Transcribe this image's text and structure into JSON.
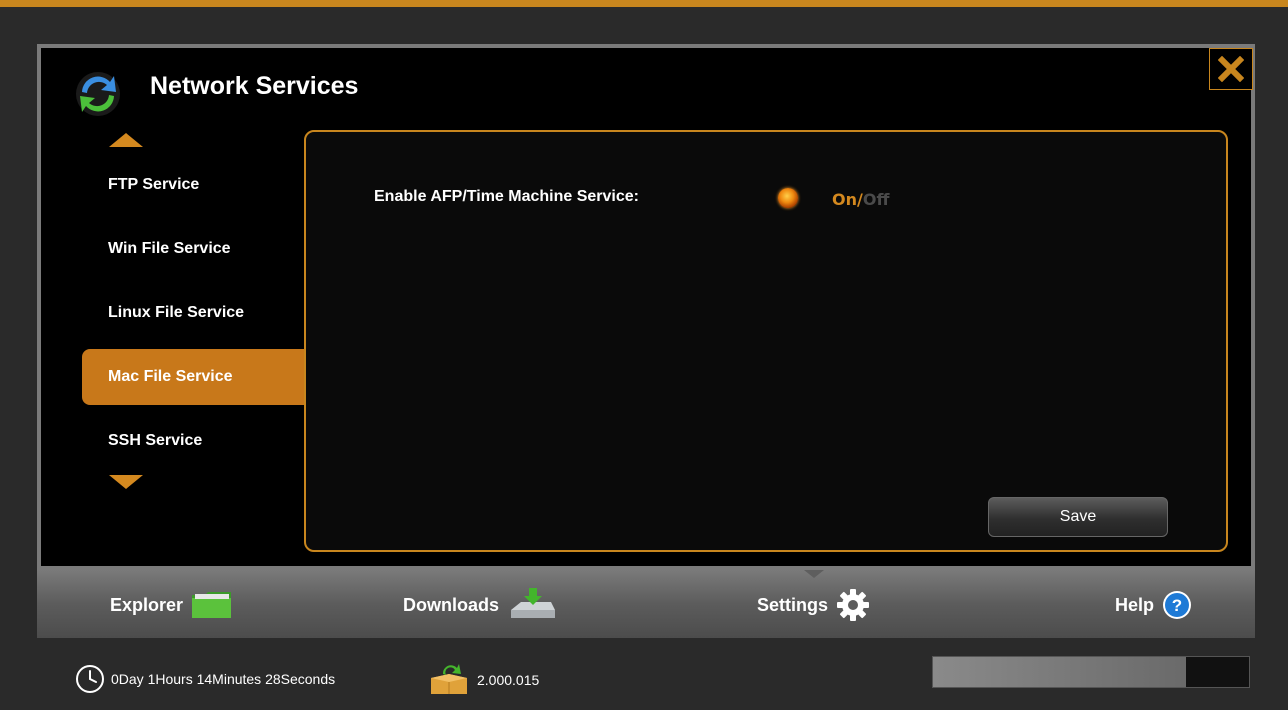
{
  "window": {
    "title": "Network Services",
    "close_icon": "close-icon"
  },
  "sidebar": {
    "items": [
      {
        "label": "FTP Service",
        "active": false
      },
      {
        "label": "Win File Service",
        "active": false
      },
      {
        "label": "Linux File Service",
        "active": false
      },
      {
        "label": "Mac File Service",
        "active": true
      },
      {
        "label": "SSH Service",
        "active": false
      }
    ]
  },
  "panel": {
    "field_label": "Enable AFP/Time Machine Service:",
    "toggle": {
      "on": "On",
      "separator": "/",
      "off": "Off",
      "selected": "On"
    },
    "save_label": "Save"
  },
  "tabs": [
    {
      "label": "Explorer",
      "icon": "folder-icon"
    },
    {
      "label": "Downloads",
      "icon": "download-drive-icon"
    },
    {
      "label": "Settings",
      "icon": "gear-icon",
      "active": true
    },
    {
      "label": "Help",
      "icon": "help-icon"
    }
  ],
  "status": {
    "uptime": "0Day 1Hours 14Minutes 28Seconds",
    "version": "2.000.015",
    "progress": 0.8
  },
  "colors": {
    "accent": "#c8861e",
    "active_tab": "#c8781a"
  }
}
